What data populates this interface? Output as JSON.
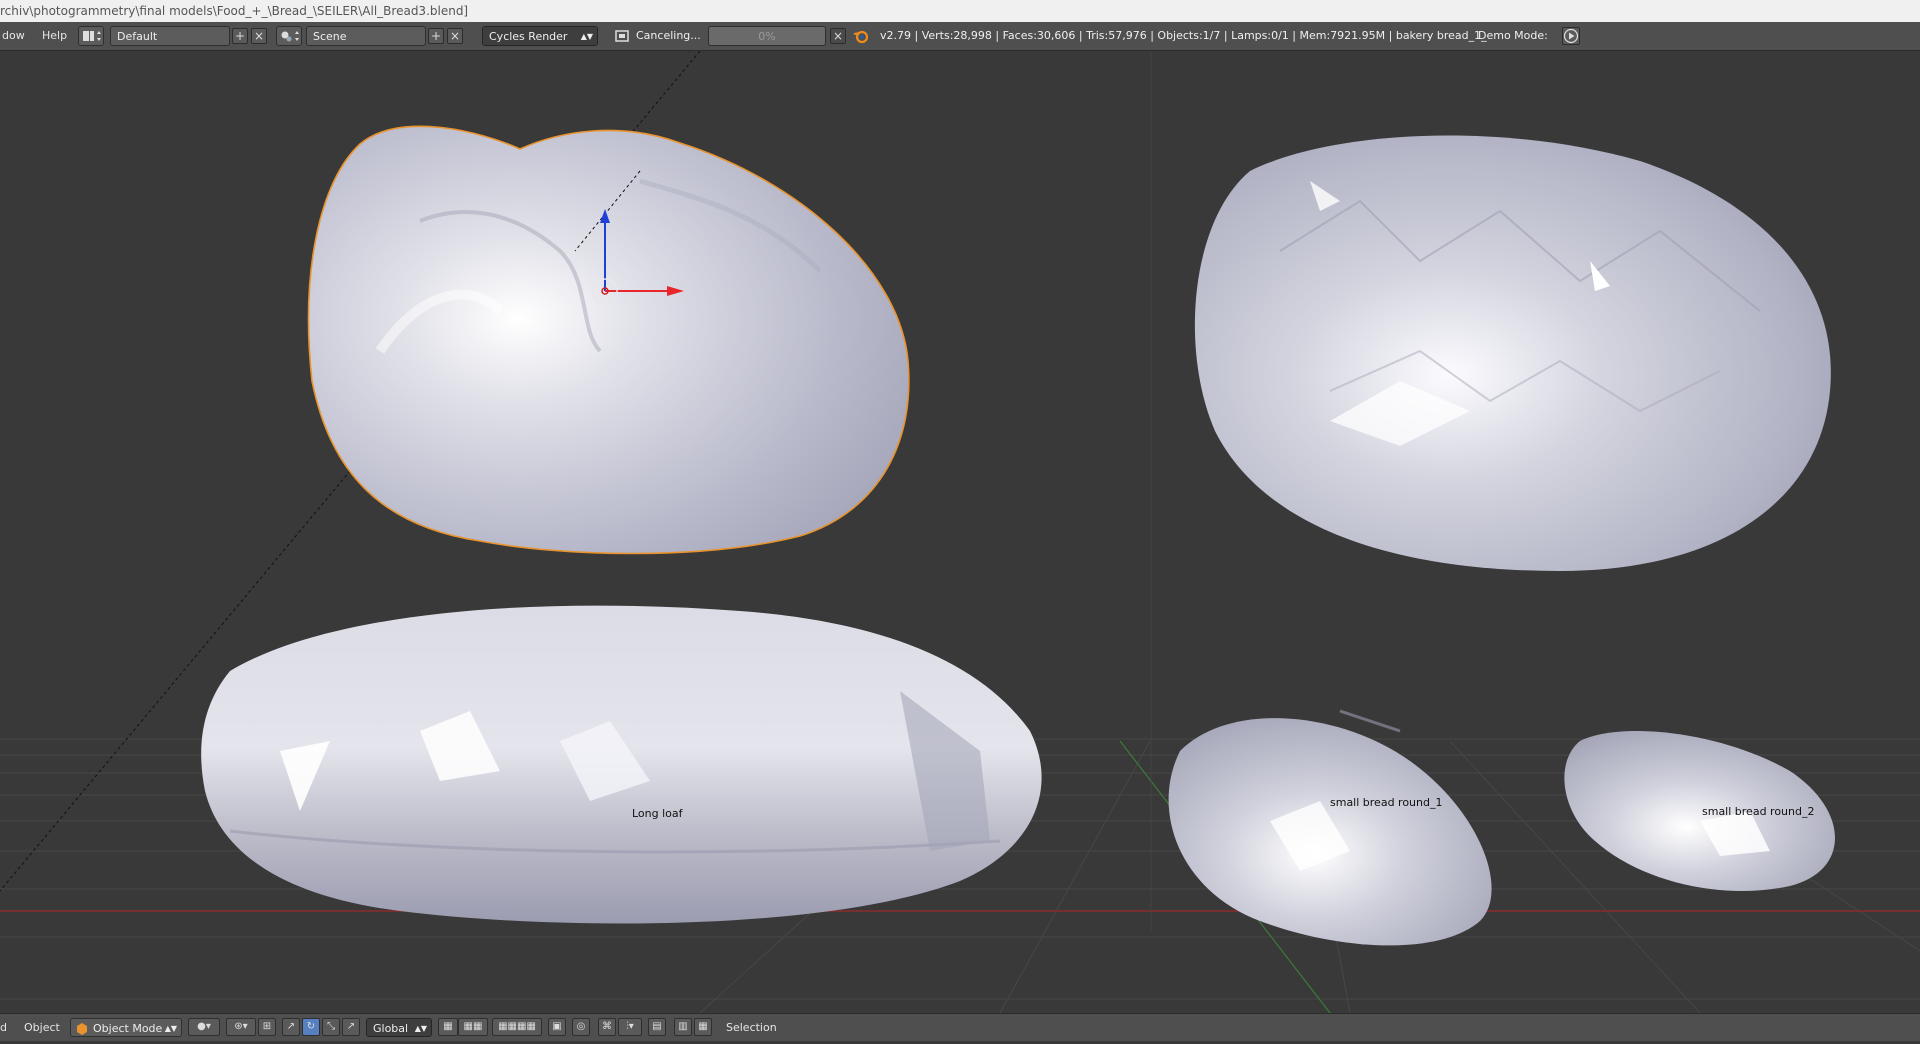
{
  "title_bar": {
    "path": "rchiv\\photogrammetry\\final models\\Food_+_\\Bread_\\SEILER\\All_Bread3.blend]"
  },
  "info_header": {
    "menu_window": "dow",
    "menu_help": "Help",
    "screen_layout": "Default",
    "scene": "Scene",
    "render_engine": "Cycles Render",
    "job_status": "Canceling...",
    "progress_percent": 0,
    "progress_label": "0%",
    "stats": "v2.79 | Verts:28,998 | Faces:30,606 | Tris:57,976 | Objects:1/7 | Lamps:0/1 | Mem:7921.95M | bakery bread_1_",
    "demo_mode_label": "Demo Mode:"
  },
  "viewport": {
    "objects": [
      {
        "label": "Long loaf"
      },
      {
        "label": "small bread round_1"
      },
      {
        "label": "small bread round_2"
      }
    ]
  },
  "bottom_header": {
    "menu_partial": "d",
    "menu_object": "Object",
    "mode": "Object Mode",
    "orientation": "Global",
    "selection_label": "Selection"
  },
  "colors": {
    "background": "#393939",
    "header": "#4f4f4f",
    "mesh": "#c9cad6",
    "selection_outline": "#e8932e",
    "axis_x": "#e8262b",
    "axis_z": "#1f3fd6"
  },
  "icons": [
    "layout-icon",
    "scene-icon",
    "plus-icon",
    "close-icon",
    "render-icon",
    "blender-logo-icon",
    "play-icon",
    "object-mode-icon",
    "shading-icon",
    "pivot-icon",
    "manipulator-icon",
    "translate-icon",
    "rotate-icon",
    "scale-icon",
    "layer-grid-icon",
    "snap-icon",
    "proportional-icon",
    "render-preview-icon"
  ]
}
